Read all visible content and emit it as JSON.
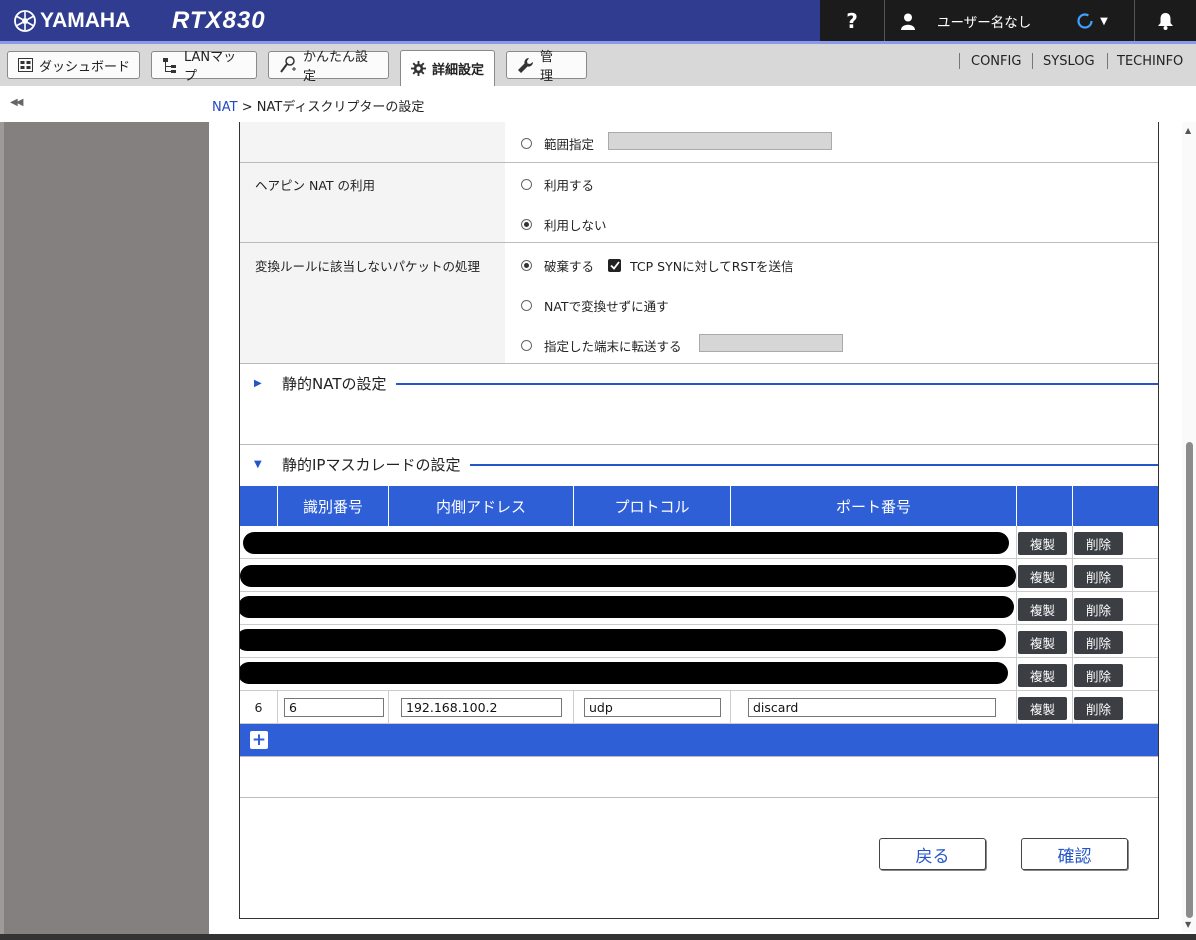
{
  "header": {
    "brand": "YAMAHA",
    "model": "RTX830",
    "help_label": "?",
    "user_label": "ユーザー名なし",
    "colors": {
      "header_bg": "#2f3c8f",
      "accent": "#2f5fd6"
    }
  },
  "nav": {
    "dashboard": "ダッシュボード",
    "lanmap": "LANマップ",
    "easy": "かんたん設定",
    "advanced": "詳細設定",
    "admin": "管　理",
    "config": "CONFIG",
    "syslog": "SYSLOG",
    "techinfo": "TECHINFO"
  },
  "breadcrumb": {
    "collapse": "◀◀",
    "link": "NAT",
    "sep": " > ",
    "current": "NATディスクリプターの設定"
  },
  "form": {
    "range_label": "範囲指定",
    "hairpin": {
      "label": "ヘアピン NAT の利用",
      "opt_use": "利用する",
      "opt_nouse": "利用しない",
      "selected": "利用しない"
    },
    "nomatch": {
      "label": "変換ルールに該当しないパケットの処理",
      "opt_discard": "破棄する",
      "checkbox_label": "TCP SYNに対してRSTを送信",
      "checkbox_checked": true,
      "opt_pass": "NATで変換せずに通す",
      "opt_forward": "指定した端末に転送する",
      "selected": "破棄する"
    }
  },
  "static_nat": {
    "title": "静的NATの設定",
    "expanded": false
  },
  "masquerade": {
    "title": "静的IPマスカレードの設定",
    "expanded": true,
    "columns": [
      "識別番号",
      "内側アドレス",
      "プロトコル",
      "ポート番号"
    ],
    "copy_label": "複製",
    "delete_label": "削除",
    "rows": [
      {
        "redacted": true
      },
      {
        "redacted": true
      },
      {
        "redacted": true
      },
      {
        "redacted": true
      },
      {
        "redacted": true
      },
      {
        "no": "6",
        "id": "6",
        "address": "192.168.100.2",
        "protocol": "udp",
        "port": "discard"
      }
    ]
  },
  "actions": {
    "back": "戻る",
    "confirm": "確認"
  }
}
